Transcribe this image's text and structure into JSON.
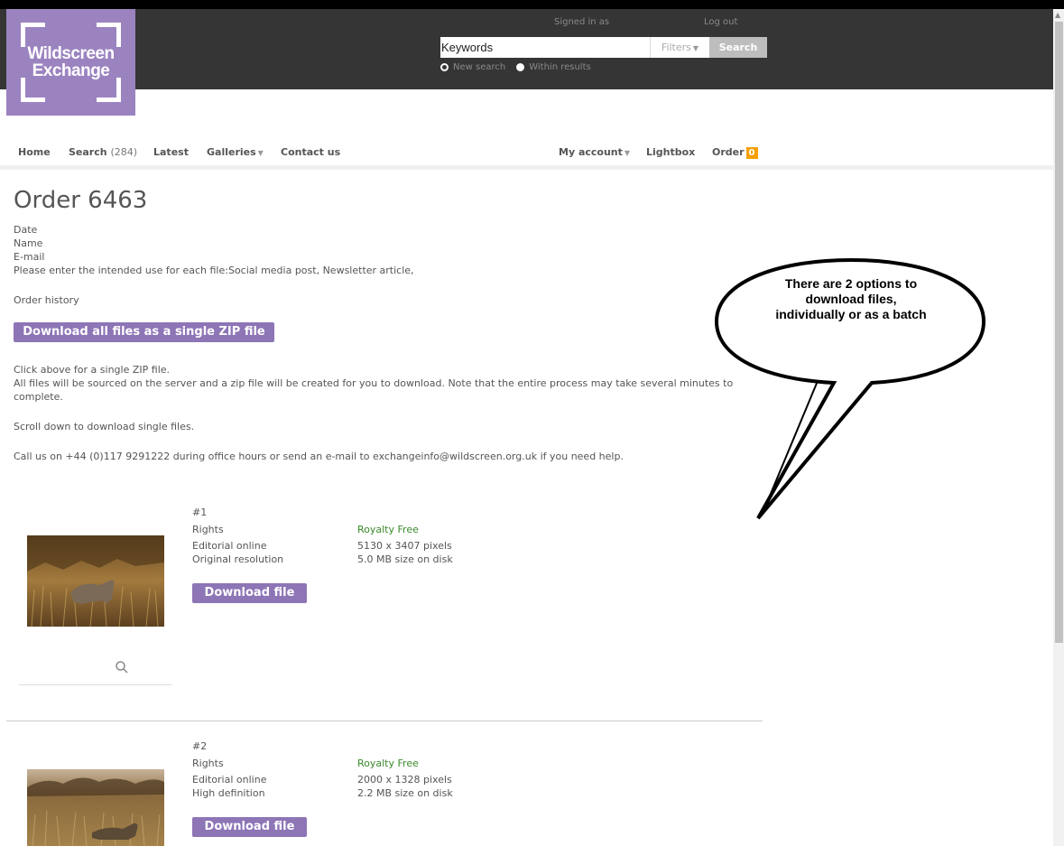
{
  "header": {
    "logo_line1": "Wildscreen",
    "logo_line2": "Exchange",
    "signed_in": "Signed in as",
    "log_out": "Log out",
    "search_value": "Keywords",
    "filters_label": "Filters",
    "search_button": "Search",
    "radio_new": "New search",
    "radio_within": "Within results"
  },
  "nav": {
    "home": "Home",
    "search": "Search",
    "search_count": "(284)",
    "latest": "Latest",
    "galleries": "Galleries",
    "contact": "Contact us",
    "my_account": "My account",
    "lightbox": "Lightbox",
    "order": "Order",
    "order_count": "0"
  },
  "order": {
    "title": "Order 6463",
    "date_label": "Date",
    "name_label": "Name",
    "email_label": "E-mail",
    "intended_use": "Please enter the intended use for each file:Social media post, Newsletter article,",
    "history": "Order history",
    "zip_button": "Download all files as a single ZIP file",
    "zip_line1": "Click above for a single ZIP file.",
    "zip_line2": "All files will be sourced on the server and a zip file will be created for you to download. Note that the entire process may take several minutes to complete.",
    "scroll_note": "Scroll down to download single files.",
    "help": "Call us on +44 (0)117 9291222 during office hours or send an e-mail to exchangeinfo@wildscreen.org.uk if you need help."
  },
  "items": [
    {
      "number": "#1",
      "rights_label": "Rights",
      "rights_value": "Royalty Free",
      "usage": "Editorial online",
      "pixels": "5130 x 3407 pixels",
      "resolution": "Original resolution",
      "size": "5.0 MB size on disk",
      "button": "Download file"
    },
    {
      "number": "#2",
      "rights_label": "Rights",
      "rights_value": "Royalty Free",
      "usage": "Editorial online",
      "pixels": "2000 x 1328 pixels",
      "resolution": "High definition",
      "size": "2.2 MB size on disk",
      "button": "Download file"
    }
  ],
  "callout": {
    "line1": "There are 2 options to",
    "line2": "download files,",
    "line3": "individually or as a batch"
  },
  "colors": {
    "accent": "#8d75b6",
    "logo": "#9b83c0",
    "header": "#353535",
    "badge": "#f5a000",
    "rights": "#3a8a2a"
  },
  "icons": [
    "search-icon",
    "caret-down-icon",
    "radio-icon"
  ]
}
